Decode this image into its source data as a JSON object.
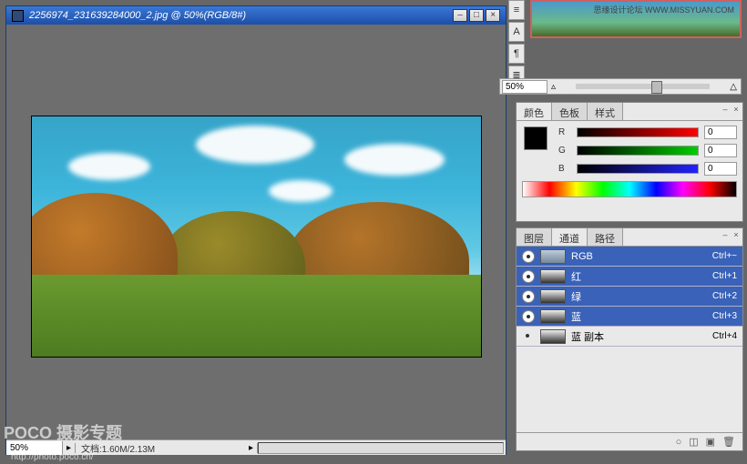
{
  "doc": {
    "title": "2256974_231639284000_2.jpg @ 50%(RGB/8#)",
    "zoom": "50%",
    "info": "文档:1.60M/2.13M"
  },
  "navigator": {
    "zoom_value": "50%",
    "watermark_small": "思缘设计论坛",
    "watermark_url": "WWW.MISSYUAN.COM"
  },
  "color_panel": {
    "tabs": {
      "color": "颜色",
      "swatches": "色板",
      "styles": "样式"
    },
    "r_label": "R",
    "g_label": "G",
    "b_label": "B",
    "r_value": "0",
    "g_value": "0",
    "b_value": "0"
  },
  "channels_panel": {
    "tabs": {
      "layers": "图层",
      "channels": "通道",
      "paths": "路径"
    },
    "rows": [
      {
        "name": "RGB",
        "shortcut": "Ctrl+~",
        "selected": true,
        "color": true
      },
      {
        "name": "红",
        "shortcut": "Ctrl+1",
        "selected": true,
        "color": false
      },
      {
        "name": "绿",
        "shortcut": "Ctrl+2",
        "selected": true,
        "color": false
      },
      {
        "name": "蓝",
        "shortcut": "Ctrl+3",
        "selected": true,
        "color": false
      },
      {
        "name": "蓝 副本",
        "shortcut": "Ctrl+4",
        "selected": false,
        "color": false
      }
    ]
  },
  "watermark": {
    "logo": "POCO 摄影专题",
    "url": "http://photo.poco.cn/"
  }
}
